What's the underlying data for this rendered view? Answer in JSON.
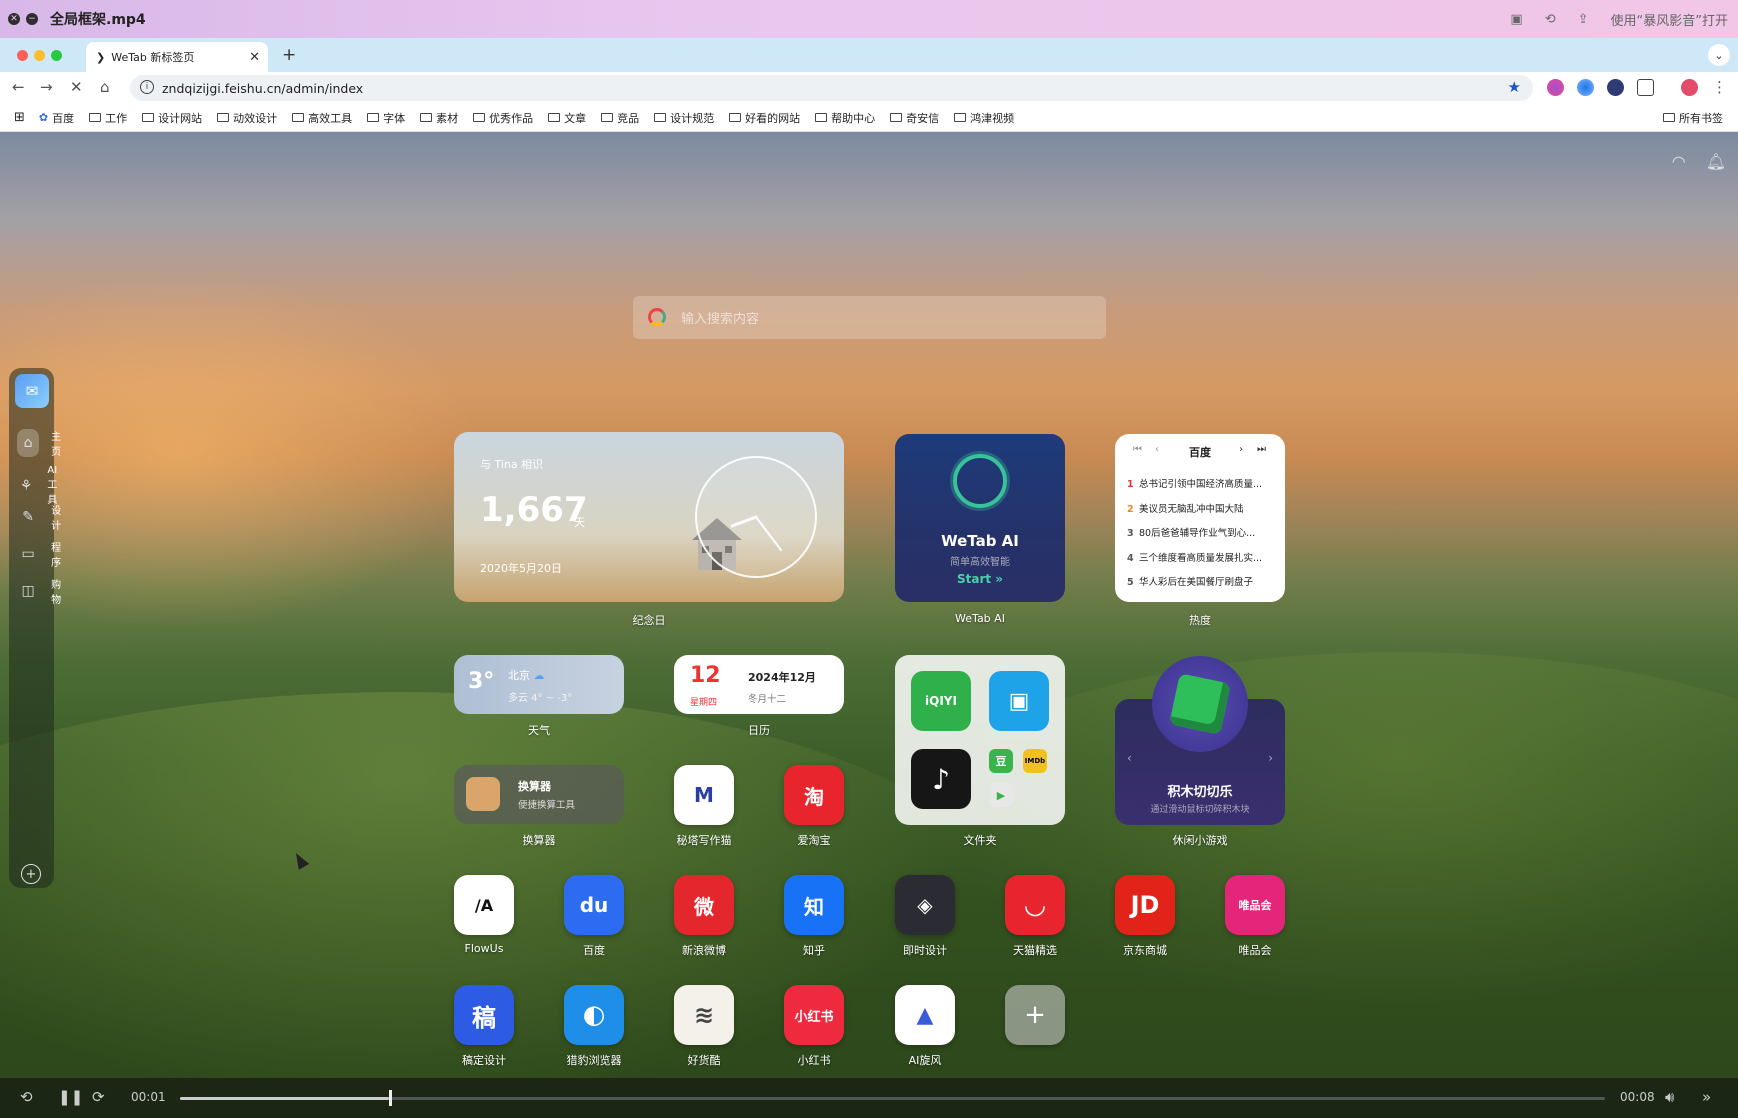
{
  "player": {
    "title": "全局框架.mp4",
    "open_with": "使用“暴风影音”打开",
    "time_current": "00:01",
    "time_total": "00:08",
    "progress": 0.147
  },
  "browser": {
    "tab_title": "WeTab 新标签页",
    "url": "zndqizijgi.feishu.cn/admin/index",
    "bookmarks": [
      "百度",
      "工作",
      "设计网站",
      "动效设计",
      "高效工具",
      "字体",
      "素材",
      "优秀作品",
      "文章",
      "竞品",
      "设计规范",
      "好看的网站",
      "帮助中心",
      "奇安信",
      "鸿津视频"
    ],
    "all_bookmarks": "所有书签"
  },
  "search": {
    "placeholder": "输入搜索内容"
  },
  "sidebar": {
    "items": [
      {
        "label": "主页",
        "icon": "home-icon"
      },
      {
        "label": "AI工具",
        "icon": "ai-icon"
      },
      {
        "label": "设计",
        "icon": "pen-icon"
      },
      {
        "label": "程序",
        "icon": "code-icon"
      },
      {
        "label": "购物",
        "icon": "bag-icon"
      }
    ]
  },
  "widgets": {
    "anniversary": {
      "who": "与 Tina 相识",
      "days": "1,667",
      "unit": "天",
      "date": "2020年5月20日",
      "label": "纪念日"
    },
    "wetab_ai": {
      "title": "WeTab AI",
      "subtitle": "简单高效智能",
      "start": "Start »",
      "label": "WeTab AI"
    },
    "hot": {
      "source": "百度",
      "label": "热度",
      "items": [
        {
          "n": "1",
          "text": "总书记引领中国经济高质量..."
        },
        {
          "n": "2",
          "text": "美议员无脑乱冲中国大陆"
        },
        {
          "n": "3",
          "text": "80后爸爸辅导作业气到心..."
        },
        {
          "n": "4",
          "text": "三个维度看高质量发展扎实..."
        },
        {
          "n": "5",
          "text": "华人彩后在美国餐厅刷盘子"
        }
      ]
    },
    "weather": {
      "temp": "3°",
      "city": "北京",
      "range": "多云 4° ~ -3°",
      "label": "天气"
    },
    "calendar": {
      "day": "12",
      "weekday": "星期四",
      "yearmonth": "2024年12月",
      "lunar": "冬月十二",
      "label": "日历"
    },
    "calculator": {
      "title": "换算器",
      "subtitle": "便捷换算工具",
      "label": "换算器"
    },
    "folder": {
      "label": "文件夹"
    },
    "game": {
      "title": "积木切切乐",
      "subtitle": "通过滑动鼠标切碎积木块",
      "label": "休闲小游戏"
    }
  },
  "apps_row1": [
    {
      "label": "秘塔写作猫",
      "glyph": "M",
      "color": "#ffffff",
      "fg": "#2a3ea8"
    },
    {
      "label": "爱淘宝",
      "glyph": "淘",
      "color": "#e8252c",
      "fg": "#ffffff"
    }
  ],
  "apps_row2": [
    {
      "label": "FlowUs",
      "glyph": "/A",
      "color": "#ffffff",
      "fg": "#111111"
    },
    {
      "label": "百度",
      "glyph": "du",
      "color": "#2d6cf0",
      "fg": "#ffffff"
    },
    {
      "label": "新浪微博",
      "glyph": "微",
      "color": "#e3272c",
      "fg": "#ffffff"
    },
    {
      "label": "知乎",
      "glyph": "知",
      "color": "#1772f6",
      "fg": "#ffffff"
    },
    {
      "label": "即时设计",
      "glyph": "◈",
      "color": "#2b2b33",
      "fg": "#ffffff"
    },
    {
      "label": "天猫精选",
      "glyph": "◡",
      "color": "#e8242f",
      "fg": "#ffffff"
    },
    {
      "label": "京东商城",
      "glyph": "JD",
      "color": "#e2231a",
      "fg": "#ffffff"
    },
    {
      "label": "唯品会",
      "glyph": "唯品会",
      "color": "#e4257a",
      "fg": "#ffffff"
    }
  ],
  "apps_row3": [
    {
      "label": "稿定设计",
      "glyph": "稿",
      "color": "#2d5be3",
      "fg": "#ffffff"
    },
    {
      "label": "猎豹浏览器",
      "glyph": "◐",
      "color": "#1e8ee8",
      "fg": "#ffffff"
    },
    {
      "label": "好货酷",
      "glyph": "≋",
      "color": "#f4f1ea",
      "fg": "#444444"
    },
    {
      "label": "小红书",
      "glyph": "小红书",
      "color": "#ef2a3f",
      "fg": "#ffffff"
    },
    {
      "label": "AI旋风",
      "glyph": "▲",
      "color": "#ffffff",
      "fg": "#3a5bd8"
    }
  ],
  "folder_apps": [
    {
      "name": "iqiyi",
      "glyph": "iQIYI",
      "color": "#2fb04a"
    },
    {
      "name": "bilibili",
      "glyph": "▣",
      "color": "#1fa3e8"
    },
    {
      "name": "douyin",
      "glyph": "♪",
      "color": "#161616"
    },
    {
      "name": "douban",
      "glyph": "豆",
      "color": "#3bb34a"
    },
    {
      "name": "imdb",
      "glyph": "IMDb",
      "color": "#f1c21b"
    },
    {
      "name": "play",
      "glyph": "▶",
      "color": "#e8e8e8"
    }
  ]
}
